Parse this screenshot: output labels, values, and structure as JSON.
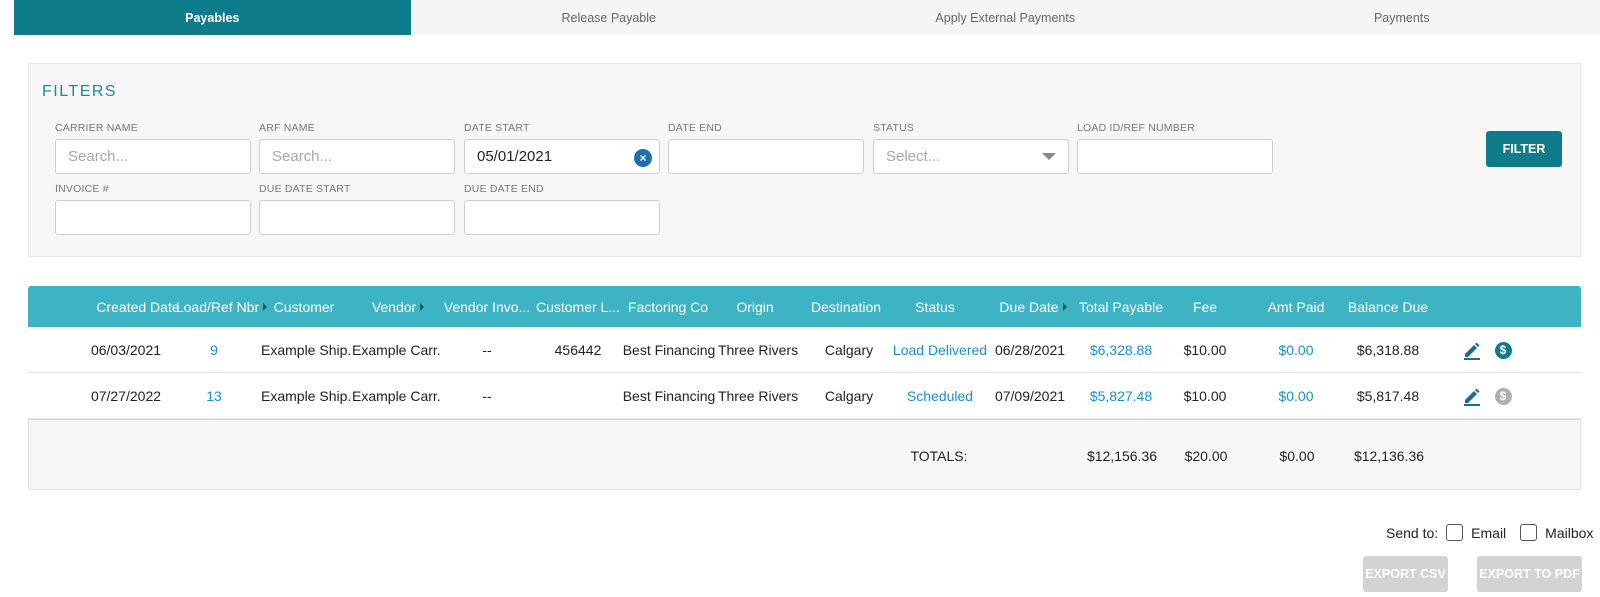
{
  "tabs": [
    {
      "label": "Payables"
    },
    {
      "label": "Release Payable"
    },
    {
      "label": "Apply External Payments"
    },
    {
      "label": "Payments"
    }
  ],
  "filters": {
    "title": "FILTERS",
    "carrier_name": {
      "label": "CARRIER NAME",
      "placeholder": "Search...",
      "value": ""
    },
    "arf_name": {
      "label": "ARF NAME",
      "placeholder": "Search...",
      "value": ""
    },
    "date_start": {
      "label": "DATE START",
      "value": "05/01/2021"
    },
    "date_end": {
      "label": "DATE END",
      "value": ""
    },
    "status": {
      "label": "STATUS",
      "placeholder": "Select..."
    },
    "load_id": {
      "label": "LOAD ID/REF NUMBER",
      "value": ""
    },
    "invoice": {
      "label": "INVOICE #",
      "value": ""
    },
    "due_date_start": {
      "label": "DUE DATE START",
      "value": ""
    },
    "due_date_end": {
      "label": "DUE DATE END",
      "value": ""
    },
    "filter_button": "FILTER"
  },
  "table": {
    "headers": [
      "Created Date",
      "Load/Ref Nbr",
      "Customer",
      "Vendor",
      "Vendor Invo...",
      "Customer L...",
      "Factoring Co",
      "Origin",
      "Destination",
      "Status",
      "Due Date",
      "Total Payable",
      "Fee",
      "Amt Paid",
      "Balance Due"
    ],
    "rows": [
      {
        "created": "06/03/2021",
        "load": "9",
        "customer": "Example Ship...",
        "vendor": "Example Carr...",
        "vendor_invoice": "--",
        "customer_load": "456442",
        "factoring": "Best Financing",
        "origin": "Three Rivers",
        "destination": "Calgary",
        "status": "Load Delivered",
        "due_date": "06/28/2021",
        "total_payable": "$6,328.88",
        "fee": "$10.00",
        "amt_paid": "$0.00",
        "balance_due": "$6,318.88",
        "pay_icon_color": "#0e7c8a"
      },
      {
        "created": "07/27/2022",
        "load": "13",
        "customer": "Example Ship...",
        "vendor": "Example Carr...",
        "vendor_invoice": "--",
        "customer_load": "",
        "factoring": "Best Financing",
        "origin": "Three Rivers",
        "destination": "Calgary",
        "status": "Scheduled",
        "due_date": "07/09/2021",
        "total_payable": "$5,827.48",
        "fee": "$10.00",
        "amt_paid": "$0.00",
        "balance_due": "$5,817.48",
        "pay_icon_color": "#b0b0b0"
      }
    ],
    "totals": {
      "label": "TOTALS:",
      "total_payable": "$12,156.36",
      "fee": "$20.00",
      "amt_paid": "$0.00",
      "balance_due": "$12,136.36"
    }
  },
  "footer": {
    "send_to_label": "Send to:",
    "email_label": "Email",
    "mailbox_label": "Mailbox",
    "export_csv": "EXPORT CSV",
    "export_pdf": "EXPORT TO PDF"
  },
  "colors": {
    "primary": "#0e7c8a",
    "header": "#3db3c4",
    "link": "#1a8fd0",
    "disabled": "#d3d3d3"
  }
}
